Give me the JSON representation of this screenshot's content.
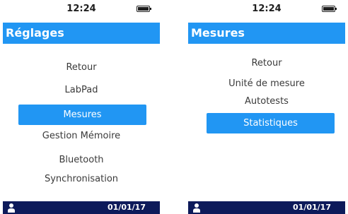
{
  "screens": [
    {
      "time": "12:24",
      "title": "Réglages",
      "menu": [
        "Retour",
        "LabPad",
        "Mesures",
        "Gestion Mémoire",
        "Bluetooth",
        "Synchronisation"
      ],
      "selected_index": 2,
      "footer_date": "01/01/17"
    },
    {
      "time": "12:24",
      "title": "Mesures",
      "menu": [
        "Retour",
        "Unité de mesure",
        "Autotests",
        "Statistiques"
      ],
      "selected_index": 3,
      "footer_date": "01/01/17"
    }
  ],
  "colors": {
    "accent": "#2196f3",
    "footer": "#0d1a5a",
    "text": "#3a3a3a"
  },
  "icons": {
    "battery": "battery-full-icon",
    "user": "user-icon"
  }
}
